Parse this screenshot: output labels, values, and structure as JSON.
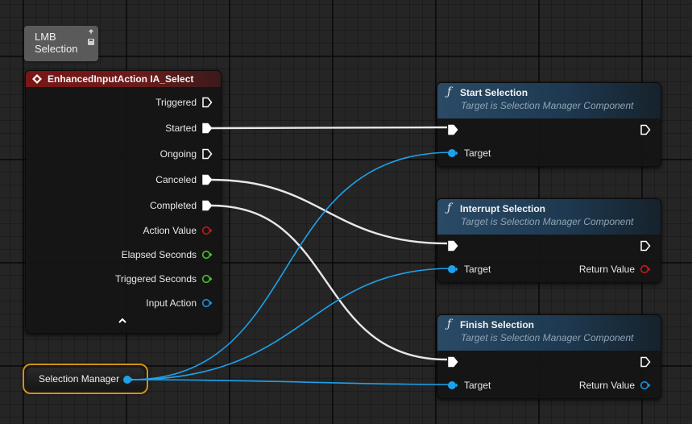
{
  "comment": {
    "text": "LMB\nSelection"
  },
  "event_node": {
    "title": "EnhancedInputAction IA_Select",
    "pins": [
      {
        "label": "Triggered",
        "type": "exec",
        "connected": false
      },
      {
        "label": "Started",
        "type": "exec",
        "connected": true
      },
      {
        "label": "Ongoing",
        "type": "exec",
        "connected": false
      },
      {
        "label": "Canceled",
        "type": "exec",
        "connected": true
      },
      {
        "label": "Completed",
        "type": "exec",
        "connected": true
      },
      {
        "label": "Action Value",
        "type": "data",
        "color": "#c01a1a"
      },
      {
        "label": "Elapsed Seconds",
        "type": "data",
        "color": "#49c22b"
      },
      {
        "label": "Triggered Seconds",
        "type": "data",
        "color": "#49c22b"
      },
      {
        "label": "Input Action",
        "type": "data",
        "color": "#1a8fe0"
      }
    ]
  },
  "functions": [
    {
      "title": "Start Selection",
      "subtitle": "Target is Selection Manager Component",
      "target_label": "Target",
      "return_label": ""
    },
    {
      "title": "Interrupt Selection",
      "subtitle": "Target is Selection Manager Component",
      "target_label": "Target",
      "return_label": "Return Value",
      "return_color": "#c01a1a"
    },
    {
      "title": "Finish Selection",
      "subtitle": "Target is Selection Manager Component",
      "target_label": "Target",
      "return_label": "Return Value",
      "return_color": "#1a8fe0"
    }
  ],
  "variable_node": {
    "label": "Selection Manager",
    "color": "#1ea1ea"
  },
  "icons": {
    "func": "ƒ",
    "event": "event-diamond-icon",
    "collapse": "chevron-up-icon"
  },
  "colors": {
    "exec_wire": "#e8e8e8",
    "object_wire": "#1ea1ea",
    "selection_outline": "#d4901a"
  }
}
